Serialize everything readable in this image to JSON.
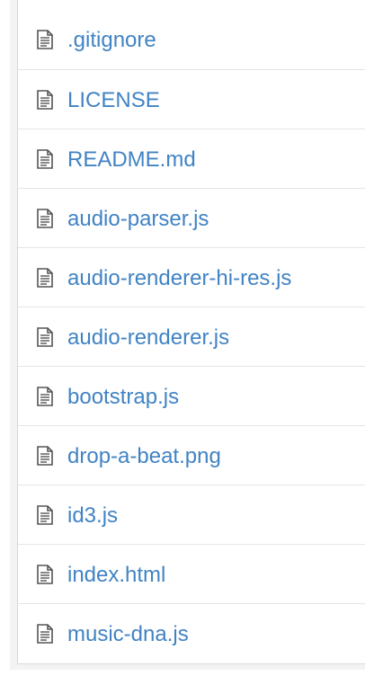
{
  "files": [
    {
      "name": ".gitignore",
      "icon": "file-text-icon"
    },
    {
      "name": "LICENSE",
      "icon": "file-text-icon"
    },
    {
      "name": "README.md",
      "icon": "file-text-icon"
    },
    {
      "name": "audio-parser.js",
      "icon": "file-text-icon"
    },
    {
      "name": "audio-renderer-hi-res.js",
      "icon": "file-text-icon"
    },
    {
      "name": "audio-renderer.js",
      "icon": "file-text-icon"
    },
    {
      "name": "bootstrap.js",
      "icon": "file-text-icon"
    },
    {
      "name": "drop-a-beat.png",
      "icon": "file-text-icon"
    },
    {
      "name": "id3.js",
      "icon": "file-text-icon"
    },
    {
      "name": "index.html",
      "icon": "file-text-icon"
    },
    {
      "name": "music-dna.js",
      "icon": "file-text-icon"
    }
  ],
  "colors": {
    "link": "#4183c4",
    "border": "#d8d8d8",
    "row_divider": "#e5e5e5",
    "icon": "#555555"
  }
}
